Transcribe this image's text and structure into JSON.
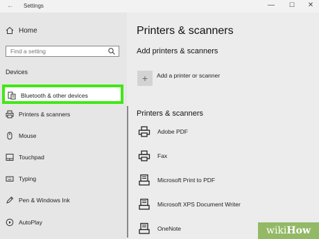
{
  "window": {
    "title": "Settings",
    "back_glyph": "←",
    "minimize_glyph": "—",
    "maximize_glyph": "☐",
    "close_glyph": "✕"
  },
  "sidebar": {
    "home_label": "Home",
    "search_placeholder": "Find a setting",
    "section_heading": "Devices",
    "items": [
      {
        "label": "Bluetooth & other devices",
        "icon": "bluetooth-devices-icon",
        "selected": true
      },
      {
        "label": "Printers & scanners",
        "icon": "printer-icon"
      },
      {
        "label": "Mouse",
        "icon": "mouse-icon"
      },
      {
        "label": "Touchpad",
        "icon": "touchpad-icon"
      },
      {
        "label": "Typing",
        "icon": "keyboard-icon"
      },
      {
        "label": "Pen & Windows Ink",
        "icon": "pen-icon"
      },
      {
        "label": "AutoPlay",
        "icon": "autoplay-icon"
      }
    ]
  },
  "main": {
    "title": "Printers & scanners",
    "add_heading": "Add printers & scanners",
    "add_button_label": "Add a printer or scanner",
    "list_heading": "Printers & scanners",
    "devices": [
      {
        "label": "Adobe PDF",
        "icon": "printer-icon"
      },
      {
        "label": "Fax",
        "icon": "printer-icon"
      },
      {
        "label": "Microsoft Print to PDF",
        "icon": "document-printer-icon"
      },
      {
        "label": "Microsoft XPS Document Writer",
        "icon": "document-printer-icon"
      },
      {
        "label": "OneNote",
        "icon": "document-printer-icon"
      }
    ]
  },
  "colors": {
    "highlight": "#41e815",
    "watermark": "#93b966"
  },
  "watermark": {
    "prefix": "wiki",
    "suffix": "How"
  }
}
